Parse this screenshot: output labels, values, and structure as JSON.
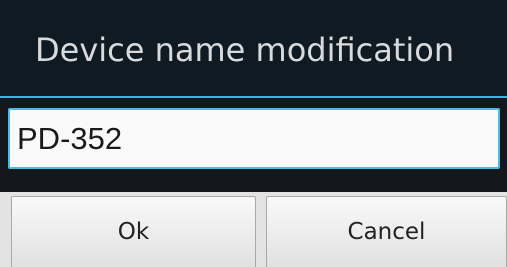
{
  "dialog": {
    "title": "Device name modification",
    "name_field": {
      "value": "PD-352",
      "placeholder": ""
    },
    "buttons": {
      "ok_label": "Ok",
      "cancel_label": "Cancel"
    }
  },
  "colors": {
    "title_background": "#101a23",
    "accent": "#35b5e0",
    "body_background": "#14171b",
    "button_background": "#f2f2f2"
  }
}
